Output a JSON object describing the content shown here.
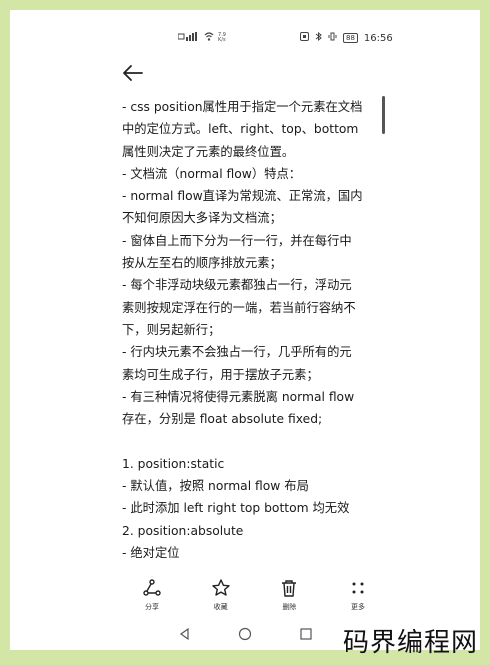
{
  "status_bar": {
    "network_speed": "7.9\nK/s",
    "battery": "88",
    "time": "16:56"
  },
  "content_lines": [
    "- css position属性用于指定一个元素在文档",
    "中的定位方式。left、right、top、bottom",
    "属性则决定了元素的最终位置。",
    "- 文档流（normal flow）特点：",
    " - normal flow直译为常规流、正常流，国内",
    "不知何原因大多译为文档流；",
    " - 窗体自上而下分为一行一行，并在每行中",
    "按从左至右的顺序排放元素；",
    " - 每个非浮动块级元素都独占一行，浮动元",
    "素则按规定浮在行的一端，若当前行容纳不",
    "下，则另起新行；",
    " - 行内块元素不会独占一行，几乎所有的元",
    "素均可生成子行，用于摆放子元素；",
    " - 有三种情况将使得元素脱离 normal flow",
    "存在，分别是 float absolute fixed;",
    "",
    "1. position:static",
    " -  默认值，按照 normal flow 布局",
    " -  此时添加 left right top bottom 均无效",
    "2. position:absolute",
    " - 绝对定位"
  ],
  "toolbar": {
    "share": "分享",
    "favorite": "收藏",
    "delete": "删除",
    "more": "更多"
  },
  "watermark": "码界编程网"
}
